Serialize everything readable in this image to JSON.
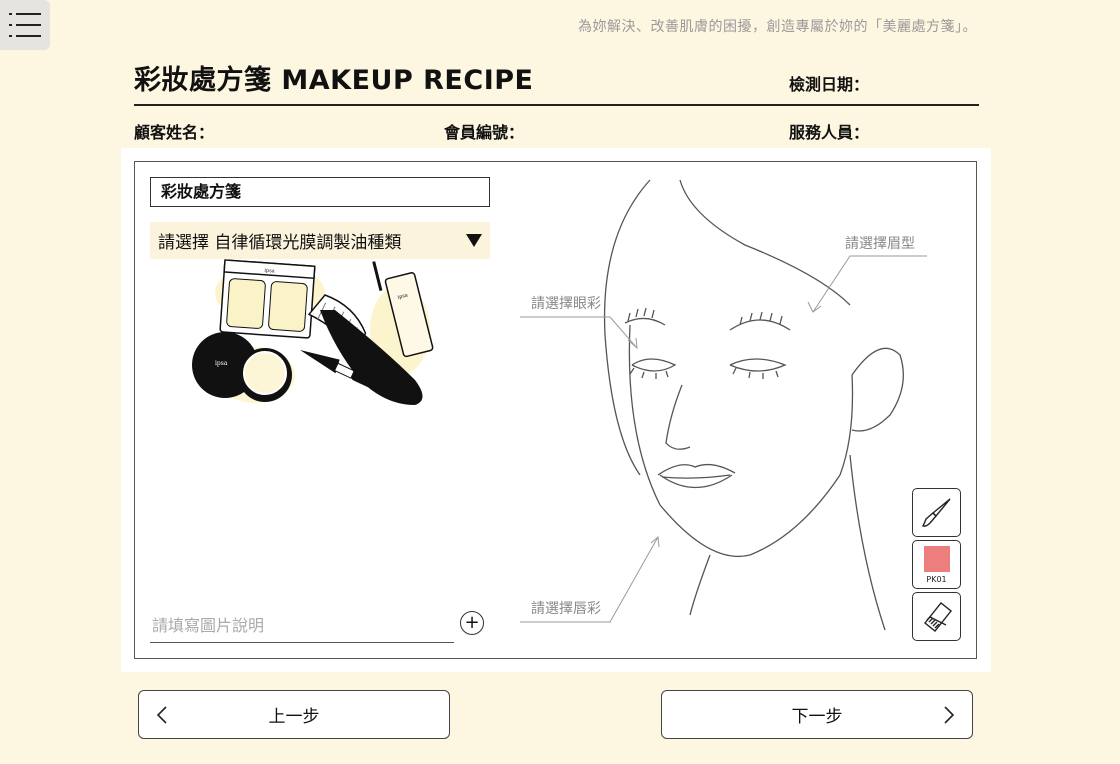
{
  "header": {
    "tagline": "為妳解決、改善肌膚的困擾，創造專屬於妳的「美麗處方箋」。",
    "title": "彩妝處方箋 MAKEUP RECIPE",
    "test_date_label": "檢測日期：",
    "customer_name_label": "顧客姓名：",
    "member_id_label": "會員編號：",
    "staff_label": "服務人員："
  },
  "recipe": {
    "box_title": "彩妝處方箋",
    "select_value": "請選擇 自律循環光膜調製油種類",
    "caption_placeholder": "請填寫圖片說明",
    "add_symbol": "+",
    "product_brand_text": "ipsa"
  },
  "face": {
    "eyebrow_label": "請選擇眉型",
    "eyeshadow_label": "請選擇眼彩",
    "lip_label": "請選擇唇彩"
  },
  "tools": {
    "swatch_code": "PK01",
    "swatch_color": "#ec7f7d"
  },
  "nav": {
    "prev_label": "上一步",
    "next_label": "下一步"
  },
  "colors": {
    "background": "#fdf6e1",
    "select_bg": "#fbf3dc",
    "highlight": "#fbf0b8"
  }
}
